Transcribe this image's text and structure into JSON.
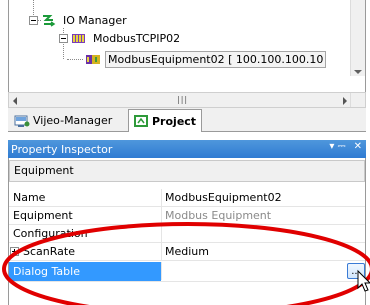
{
  "tree": {
    "nodes": [
      {
        "label": "IO Manager",
        "icon": "io-manager-icon"
      },
      {
        "label": "ModbusTCPIP02",
        "icon": "driver-icon"
      },
      {
        "label": "ModbusEquipment02 [ 100.100.100.10",
        "icon": "equipment-icon",
        "selected": true
      }
    ]
  },
  "tabs": [
    {
      "label": "Vijeo-Manager",
      "icon": "vijeo-manager-icon",
      "active": false
    },
    {
      "label": "Project",
      "icon": "project-icon",
      "active": true
    }
  ],
  "property_inspector": {
    "title": "Property Inspector",
    "pin_symbol": "▾ ⎓",
    "close_symbol": "✕",
    "category": "Equipment",
    "rows": [
      {
        "name": "Name",
        "value": "ModbusEquipment02"
      },
      {
        "name": "Equipment",
        "value": "Modbus Equipment",
        "dim": true
      },
      {
        "name": "Configuration",
        "value": ""
      },
      {
        "name": "ScanRate",
        "value": "Medium",
        "expandable": true
      },
      {
        "name": "Dialog Table",
        "value": "",
        "selected": true
      }
    ],
    "ellipsis_label": "..."
  },
  "colors": {
    "title_bar": "#2f7bd2",
    "selection": "#3399ff",
    "highlight": "#e00000"
  }
}
